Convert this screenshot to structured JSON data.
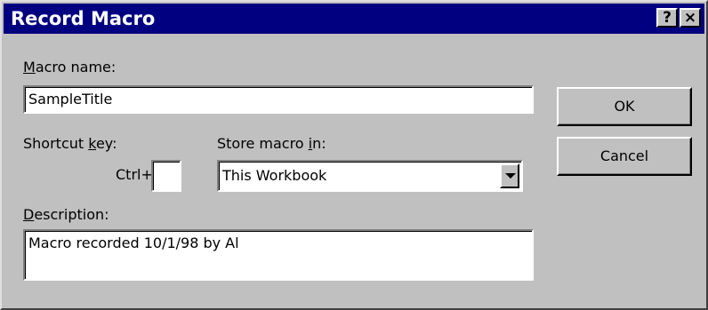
{
  "window": {
    "title": "Record Macro",
    "help_glyph": "?",
    "close_glyph": "×"
  },
  "macro_name": {
    "label_first": "M",
    "label_rest": "acro name:",
    "value": "SampleTitle"
  },
  "shortcut": {
    "label_prefix": "Shortcut ",
    "label_accel": "k",
    "label_suffix": "ey:",
    "ctrl_text": "Ctrl+",
    "value": ""
  },
  "store_in": {
    "label_prefix": "Store macro ",
    "label_accel": "i",
    "label_suffix": "n:",
    "selected": "This Workbook"
  },
  "description": {
    "label_first": "D",
    "label_rest": "escription:",
    "value": "Macro recorded 10/1/98 by Al"
  },
  "buttons": {
    "ok": "OK",
    "cancel": "Cancel"
  }
}
